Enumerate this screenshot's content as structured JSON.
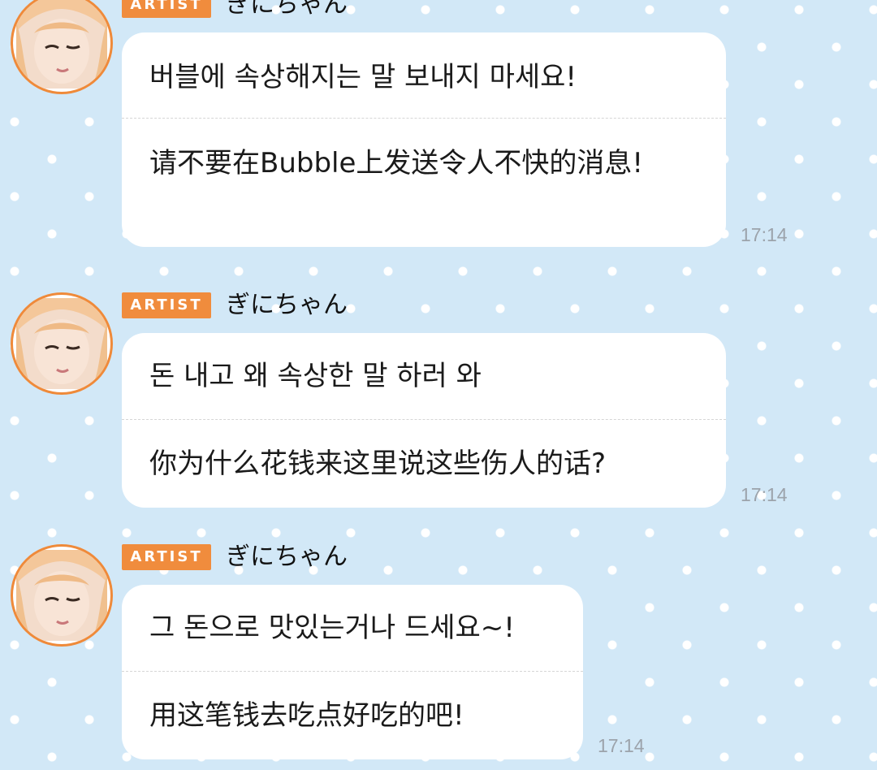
{
  "messages": [
    {
      "badge": "ARTIST",
      "sender": "ぎにちゃん",
      "korean": "버블에 속상해지는 말 보내지 마세요!",
      "chinese": "请不要在Bubble上发送令人不快的消息!",
      "time": "17:14",
      "avatar_icon": "profile-photo-avatar"
    },
    {
      "badge": "ARTIST",
      "sender": "ぎにちゃん",
      "korean": "돈 내고 왜 속상한 말 하러 와",
      "chinese": "你为什么花钱来这里说这些伤人的话?",
      "time": "17:14",
      "avatar_icon": "profile-photo-avatar"
    },
    {
      "badge": "ARTIST",
      "sender": "ぎにちゃん",
      "korean": "그 돈으로 맛있는거나 드세요~!",
      "chinese": "用这笔钱去吃点好吃的吧!",
      "time": "17:14",
      "avatar_icon": "profile-photo-avatar"
    }
  ],
  "colors": {
    "background": "#d2e8f7",
    "badge": "#f08c3d",
    "avatar_ring": "#ef8a3a",
    "bubble": "#ffffff",
    "timestamp": "#9ca3ab"
  }
}
